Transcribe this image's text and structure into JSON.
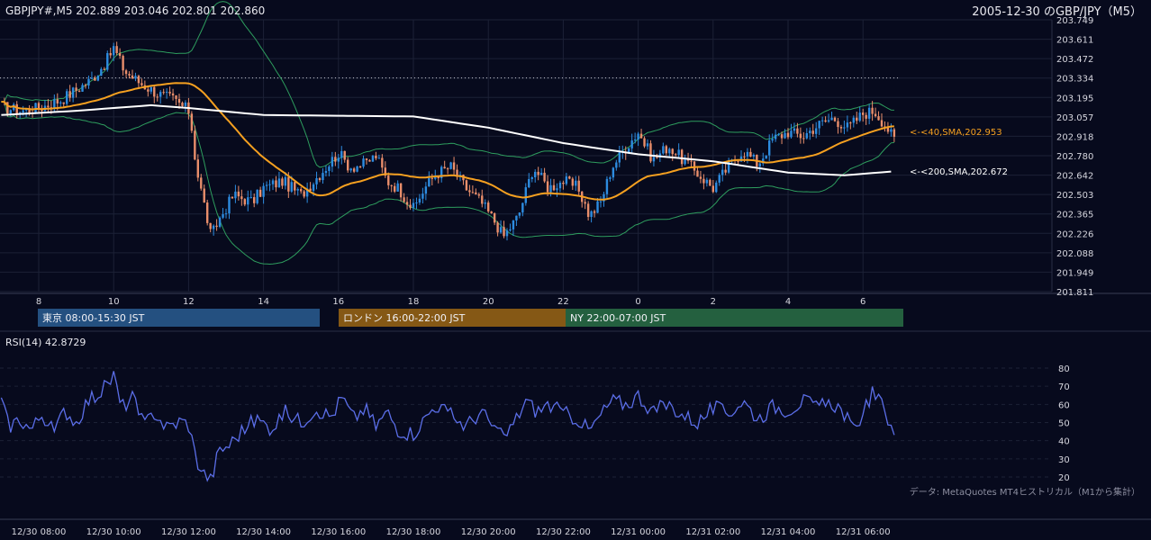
{
  "header": {
    "symbol_line": "GBPJPY#,M5 202.889 203.046 202.801 202.860",
    "title": "2005-12-30 のGBP/JPY（M5）"
  },
  "colors": {
    "background": "#070a1d",
    "bull_candle": "#2d8ce0",
    "bear_candle": "#e98e6b",
    "sma40": "#f5a020",
    "sma200": "#ffffff",
    "bollinger": "#2e9d5e",
    "rsi": "#5b6ee8",
    "tokyo": "#245080",
    "london": "#855815",
    "newyork": "#24603f"
  },
  "sessions": [
    {
      "label": "東京 08:00-15:30 JST",
      "color": "#245080"
    },
    {
      "label": "ロンドン 16:00-22:00 JST",
      "color": "#855815"
    },
    {
      "label": "NY 22:00-07:00 JST",
      "color": "#24603f"
    }
  ],
  "rsi_label": "RSI(14) 42.8729",
  "footnote": "データ: MetaQuotes MT4ヒストリカル（M1から集計）",
  "chart_data": [
    {
      "type": "candlestick",
      "title": "2005-12-30 のGBP/JPY（M5）",
      "y_ticks": [
        "203.749",
        "203.611",
        "203.472",
        "203.334",
        "203.195",
        "203.057",
        "202.918",
        "202.780",
        "202.642",
        "202.503",
        "202.365",
        "202.226",
        "202.088",
        "201.949",
        "201.811"
      ],
      "ylim": [
        201.811,
        203.749
      ],
      "x_hour_labels": [
        "8",
        "10",
        "12",
        "14",
        "16",
        "18",
        "20",
        "22",
        "0",
        "2",
        "4",
        "6"
      ],
      "x_range_hours": [
        7.0,
        30.9
      ],
      "reference_line": 203.334,
      "grid": true,
      "series": [
        {
          "name": "<-<40,SMA,202.953",
          "last": 202.953
        },
        {
          "name": "<-<200,SMA,202.672",
          "last": 202.672
        },
        {
          "name": "Bollinger Bands"
        }
      ],
      "close_path": [
        [
          7.0,
          203.13
        ],
        [
          7.5,
          203.1
        ],
        [
          8.0,
          203.12
        ],
        [
          8.6,
          203.18
        ],
        [
          9.0,
          203.25
        ],
        [
          9.4,
          203.32
        ],
        [
          9.8,
          203.45
        ],
        [
          10.0,
          203.55
        ],
        [
          10.3,
          203.38
        ],
        [
          10.7,
          203.3
        ],
        [
          11.2,
          203.22
        ],
        [
          11.6,
          203.18
        ],
        [
          12.0,
          203.1
        ],
        [
          12.1,
          202.95
        ],
        [
          12.2,
          202.7
        ],
        [
          12.4,
          202.45
        ],
        [
          12.6,
          202.2
        ],
        [
          12.8,
          202.32
        ],
        [
          13.2,
          202.5
        ],
        [
          13.7,
          202.45
        ],
        [
          14.0,
          202.55
        ],
        [
          14.5,
          202.6
        ],
        [
          15.0,
          202.5
        ],
        [
          15.5,
          202.65
        ],
        [
          16.0,
          202.8
        ],
        [
          16.3,
          202.7
        ],
        [
          16.7,
          202.72
        ],
        [
          17.0,
          202.78
        ],
        [
          17.3,
          202.6
        ],
        [
          17.6,
          202.55
        ],
        [
          18.0,
          202.4
        ],
        [
          18.3,
          202.55
        ],
        [
          18.6,
          202.65
        ],
        [
          19.0,
          202.7
        ],
        [
          19.4,
          202.55
        ],
        [
          19.8,
          202.45
        ],
        [
          20.2,
          202.3
        ],
        [
          20.4,
          202.2
        ],
        [
          20.8,
          202.35
        ],
        [
          21.2,
          202.7
        ],
        [
          21.6,
          202.55
        ],
        [
          22.0,
          202.6
        ],
        [
          22.4,
          202.55
        ],
        [
          22.7,
          202.35
        ],
        [
          23.0,
          202.45
        ],
        [
          23.3,
          202.7
        ],
        [
          23.7,
          202.85
        ],
        [
          24.0,
          202.95
        ],
        [
          24.4,
          202.75
        ],
        [
          24.8,
          202.85
        ],
        [
          25.2,
          202.75
        ],
        [
          25.6,
          202.65
        ],
        [
          26.0,
          202.55
        ],
        [
          26.4,
          202.7
        ],
        [
          26.8,
          202.82
        ],
        [
          27.2,
          202.72
        ],
        [
          27.6,
          202.9
        ],
        [
          28.0,
          202.95
        ],
        [
          28.4,
          202.92
        ],
        [
          28.8,
          203.0
        ],
        [
          29.2,
          203.05
        ],
        [
          29.6,
          202.98
        ],
        [
          30.0,
          203.08
        ],
        [
          30.3,
          203.1
        ],
        [
          30.6,
          203.0
        ],
        [
          30.9,
          202.86
        ]
      ]
    },
    {
      "type": "line",
      "series": [
        {
          "name": "RSI(14) 42.8729"
        }
      ],
      "ylim": [
        20,
        80
      ],
      "y_ticks": [
        "80",
        "70",
        "60",
        "50",
        "40",
        "30",
        "20"
      ],
      "x_labels": [
        "12/30 08:00",
        "12/30 10:00",
        "12/30 12:00",
        "12/30 14:00",
        "12/30 16:00",
        "12/30 18:00",
        "12/30 20:00",
        "12/30 22:00",
        "12/31 00:00",
        "12/31 02:00",
        "12/31 04:00",
        "12/31 06:00"
      ],
      "last": 42.8729,
      "path": [
        [
          7.0,
          62
        ],
        [
          7.2,
          48
        ],
        [
          7.5,
          52
        ],
        [
          7.8,
          46
        ],
        [
          8.1,
          55
        ],
        [
          8.4,
          44
        ],
        [
          8.7,
          57
        ],
        [
          9.0,
          50
        ],
        [
          9.3,
          62
        ],
        [
          9.6,
          66
        ],
        [
          9.8,
          70
        ],
        [
          10.0,
          76
        ],
        [
          10.2,
          58
        ],
        [
          10.5,
          64
        ],
        [
          10.8,
          48
        ],
        [
          11.1,
          56
        ],
        [
          11.4,
          47
        ],
        [
          11.8,
          51
        ],
        [
          12.0,
          49
        ],
        [
          12.2,
          30
        ],
        [
          12.4,
          22
        ],
        [
          12.6,
          18
        ],
        [
          12.8,
          34
        ],
        [
          13.1,
          38
        ],
        [
          13.4,
          45
        ],
        [
          13.8,
          52
        ],
        [
          14.2,
          47
        ],
        [
          14.6,
          56
        ],
        [
          15.0,
          50
        ],
        [
          15.4,
          58
        ],
        [
          15.8,
          53
        ],
        [
          16.1,
          64
        ],
        [
          16.4,
          52
        ],
        [
          16.7,
          58
        ],
        [
          17.0,
          48
        ],
        [
          17.3,
          56
        ],
        [
          17.6,
          46
        ],
        [
          18.0,
          44
        ],
        [
          18.3,
          52
        ],
        [
          18.6,
          60
        ],
        [
          19.0,
          54
        ],
        [
          19.4,
          48
        ],
        [
          19.8,
          56
        ],
        [
          20.2,
          46
        ],
        [
          20.4,
          41
        ],
        [
          20.7,
          50
        ],
        [
          21.0,
          62
        ],
        [
          21.3,
          56
        ],
        [
          21.6,
          60
        ],
        [
          22.0,
          55
        ],
        [
          22.4,
          52
        ],
        [
          22.7,
          45
        ],
        [
          23.0,
          54
        ],
        [
          23.3,
          62
        ],
        [
          23.7,
          60
        ],
        [
          24.0,
          65
        ],
        [
          24.4,
          56
        ],
        [
          24.8,
          60
        ],
        [
          25.2,
          54
        ],
        [
          25.6,
          50
        ],
        [
          26.0,
          58
        ],
        [
          26.4,
          55
        ],
        [
          26.8,
          62
        ],
        [
          27.2,
          52
        ],
        [
          27.6,
          59
        ],
        [
          28.0,
          57
        ],
        [
          28.4,
          62
        ],
        [
          28.8,
          58
        ],
        [
          29.2,
          61
        ],
        [
          29.5,
          55
        ],
        [
          29.8,
          43
        ],
        [
          30.0,
          58
        ],
        [
          30.3,
          67
        ],
        [
          30.6,
          55
        ],
        [
          30.9,
          43
        ]
      ]
    }
  ]
}
